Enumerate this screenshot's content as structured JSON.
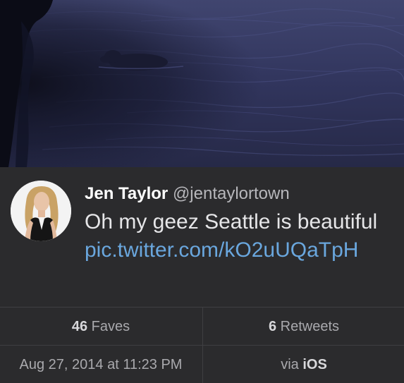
{
  "tweet": {
    "name": "Jen Taylor",
    "handle": "@jentaylortown",
    "text_plain": "Oh my geez Seattle is beautiful ",
    "text_link": "pic.twitter.com/kO2uUQaTpH"
  },
  "stats": {
    "faves_count": "46",
    "faves_label": " Faves",
    "retweets_count": "6",
    "retweets_label": " Retweets"
  },
  "meta": {
    "timestamp": "Aug 27, 2014 at 11:23 PM",
    "via_prefix": "via ",
    "via_source": "iOS"
  },
  "icons": {
    "avatar": "profile-photo"
  },
  "colors": {
    "link": "#6aa7de",
    "background": "#2b2b2d",
    "name": "#ffffff",
    "muted": "#a9a9ad"
  }
}
